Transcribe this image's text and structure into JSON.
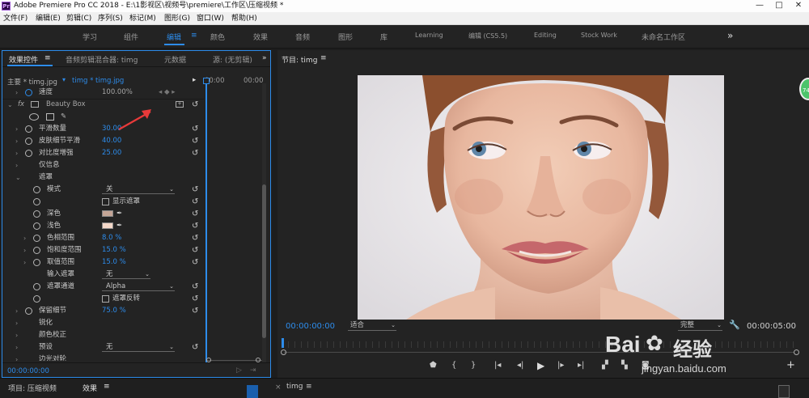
{
  "titlebar": {
    "app_icon": "Pr",
    "title": "Adobe Premiere Pro CC 2018 - E:\\1影视区\\视频号\\premiere\\工作区\\压缩视频 *",
    "min": "—",
    "max": "□",
    "close": "✕"
  },
  "menu": [
    "文件(F)",
    "编辑(E)",
    "剪辑(C)",
    "序列(S)",
    "标记(M)",
    "图形(G)",
    "窗口(W)",
    "帮助(H)"
  ],
  "workspaces": {
    "items": [
      "学习",
      "组件",
      "编辑",
      "颜色",
      "效果",
      "音频",
      "图形",
      "库",
      "Learning",
      "编辑 (CS5.5)",
      "Editing",
      "Stock Work",
      "未命名工作区"
    ],
    "active": "编辑",
    "menu_glyph": "≡",
    "more": "»"
  },
  "effect_controls": {
    "tabs": [
      "效果控件",
      "音频剪辑混合器: timg",
      "元数据",
      "源: (无剪辑)"
    ],
    "menu_glyph": "≡",
    "more": "»",
    "master": "主要 * timg.jpg",
    "clip": "timg * timg.jpg",
    "time_start": "00:00",
    "time_end": "00:00",
    "current_time": "00:00:00:00",
    "rows": {
      "speed_label": "速度",
      "speed_value": "100.00%",
      "fx": "fx",
      "effect_name": "Beauty Box",
      "smooth_label": "平滑数量",
      "smooth_value": "30.00",
      "detail_label": "皮肤细节平滑",
      "detail_value": "40.00",
      "contrast_label": "对比度增强",
      "contrast_value": "25.00",
      "info_label": "仅信息",
      "mask_label": "遮罩",
      "mode_label": "模式",
      "mode_value": "关",
      "show_mask_label": "显示遮罩",
      "dark_label": "深色",
      "light_label": "浅色",
      "hue_label": "色相范围",
      "hue_value": "8.0 %",
      "sat_label": "饱和度范围",
      "sat_value": "15.0 %",
      "val_label": "取值范围",
      "val_value": "15.0 %",
      "input_mask_label": "输入遮罩",
      "input_mask_value": "无",
      "mask_channel_label": "遮罩通道",
      "mask_channel_value": "Alpha",
      "invert_mask_label": "遮罩反转",
      "keep_detail_label": "保留细节",
      "keep_detail_value": "75.0 %",
      "sharpen_label": "锐化",
      "color_correct_label": "颜色校正",
      "preset_label": "预设",
      "preset_value": "无",
      "cutoff_label": "边光对轮"
    },
    "colors": {
      "dark_swatch": "#c4a596",
      "light_swatch": "#f3d7c8"
    }
  },
  "program": {
    "title": "节目: timg",
    "menu_glyph": "≡",
    "timecode": "00:00:00:00",
    "fit": "适合",
    "quality": "完整",
    "duration": "00:00:05:00",
    "side_badge": "74"
  },
  "watermark": {
    "brand_left": "Bai",
    "brand_right": "经验",
    "url": "jingyan.baidu.com"
  },
  "bottom": {
    "project_tab": "项目: 压缩视频",
    "effects_tab": "效果",
    "timeline_tab": "timg",
    "menu_glyph": "≡",
    "close": "×"
  },
  "accent": "#2d8ceb"
}
